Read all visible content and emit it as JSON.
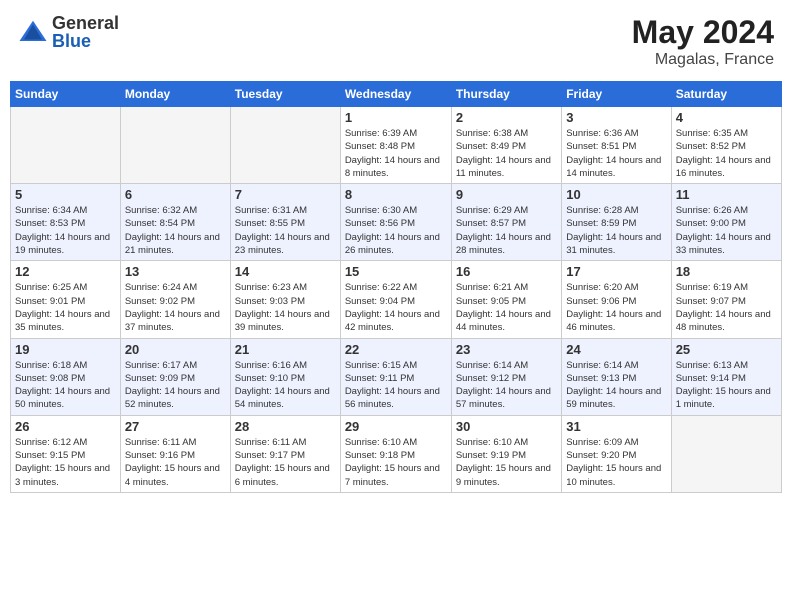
{
  "header": {
    "logo_general": "General",
    "logo_blue": "Blue",
    "month": "May 2024",
    "location": "Magalas, France"
  },
  "weekdays": [
    "Sunday",
    "Monday",
    "Tuesday",
    "Wednesday",
    "Thursday",
    "Friday",
    "Saturday"
  ],
  "weeks": [
    [
      {
        "day": "",
        "empty": true
      },
      {
        "day": "",
        "empty": true
      },
      {
        "day": "",
        "empty": true
      },
      {
        "day": "1",
        "sunrise": "Sunrise: 6:39 AM",
        "sunset": "Sunset: 8:48 PM",
        "daylight": "Daylight: 14 hours and 8 minutes."
      },
      {
        "day": "2",
        "sunrise": "Sunrise: 6:38 AM",
        "sunset": "Sunset: 8:49 PM",
        "daylight": "Daylight: 14 hours and 11 minutes."
      },
      {
        "day": "3",
        "sunrise": "Sunrise: 6:36 AM",
        "sunset": "Sunset: 8:51 PM",
        "daylight": "Daylight: 14 hours and 14 minutes."
      },
      {
        "day": "4",
        "sunrise": "Sunrise: 6:35 AM",
        "sunset": "Sunset: 8:52 PM",
        "daylight": "Daylight: 14 hours and 16 minutes."
      }
    ],
    [
      {
        "day": "5",
        "sunrise": "Sunrise: 6:34 AM",
        "sunset": "Sunset: 8:53 PM",
        "daylight": "Daylight: 14 hours and 19 minutes."
      },
      {
        "day": "6",
        "sunrise": "Sunrise: 6:32 AM",
        "sunset": "Sunset: 8:54 PM",
        "daylight": "Daylight: 14 hours and 21 minutes."
      },
      {
        "day": "7",
        "sunrise": "Sunrise: 6:31 AM",
        "sunset": "Sunset: 8:55 PM",
        "daylight": "Daylight: 14 hours and 23 minutes."
      },
      {
        "day": "8",
        "sunrise": "Sunrise: 6:30 AM",
        "sunset": "Sunset: 8:56 PM",
        "daylight": "Daylight: 14 hours and 26 minutes."
      },
      {
        "day": "9",
        "sunrise": "Sunrise: 6:29 AM",
        "sunset": "Sunset: 8:57 PM",
        "daylight": "Daylight: 14 hours and 28 minutes."
      },
      {
        "day": "10",
        "sunrise": "Sunrise: 6:28 AM",
        "sunset": "Sunset: 8:59 PM",
        "daylight": "Daylight: 14 hours and 31 minutes."
      },
      {
        "day": "11",
        "sunrise": "Sunrise: 6:26 AM",
        "sunset": "Sunset: 9:00 PM",
        "daylight": "Daylight: 14 hours and 33 minutes."
      }
    ],
    [
      {
        "day": "12",
        "sunrise": "Sunrise: 6:25 AM",
        "sunset": "Sunset: 9:01 PM",
        "daylight": "Daylight: 14 hours and 35 minutes."
      },
      {
        "day": "13",
        "sunrise": "Sunrise: 6:24 AM",
        "sunset": "Sunset: 9:02 PM",
        "daylight": "Daylight: 14 hours and 37 minutes."
      },
      {
        "day": "14",
        "sunrise": "Sunrise: 6:23 AM",
        "sunset": "Sunset: 9:03 PM",
        "daylight": "Daylight: 14 hours and 39 minutes."
      },
      {
        "day": "15",
        "sunrise": "Sunrise: 6:22 AM",
        "sunset": "Sunset: 9:04 PM",
        "daylight": "Daylight: 14 hours and 42 minutes."
      },
      {
        "day": "16",
        "sunrise": "Sunrise: 6:21 AM",
        "sunset": "Sunset: 9:05 PM",
        "daylight": "Daylight: 14 hours and 44 minutes."
      },
      {
        "day": "17",
        "sunrise": "Sunrise: 6:20 AM",
        "sunset": "Sunset: 9:06 PM",
        "daylight": "Daylight: 14 hours and 46 minutes."
      },
      {
        "day": "18",
        "sunrise": "Sunrise: 6:19 AM",
        "sunset": "Sunset: 9:07 PM",
        "daylight": "Daylight: 14 hours and 48 minutes."
      }
    ],
    [
      {
        "day": "19",
        "sunrise": "Sunrise: 6:18 AM",
        "sunset": "Sunset: 9:08 PM",
        "daylight": "Daylight: 14 hours and 50 minutes."
      },
      {
        "day": "20",
        "sunrise": "Sunrise: 6:17 AM",
        "sunset": "Sunset: 9:09 PM",
        "daylight": "Daylight: 14 hours and 52 minutes."
      },
      {
        "day": "21",
        "sunrise": "Sunrise: 6:16 AM",
        "sunset": "Sunset: 9:10 PM",
        "daylight": "Daylight: 14 hours and 54 minutes."
      },
      {
        "day": "22",
        "sunrise": "Sunrise: 6:15 AM",
        "sunset": "Sunset: 9:11 PM",
        "daylight": "Daylight: 14 hours and 56 minutes."
      },
      {
        "day": "23",
        "sunrise": "Sunrise: 6:14 AM",
        "sunset": "Sunset: 9:12 PM",
        "daylight": "Daylight: 14 hours and 57 minutes."
      },
      {
        "day": "24",
        "sunrise": "Sunrise: 6:14 AM",
        "sunset": "Sunset: 9:13 PM",
        "daylight": "Daylight: 14 hours and 59 minutes."
      },
      {
        "day": "25",
        "sunrise": "Sunrise: 6:13 AM",
        "sunset": "Sunset: 9:14 PM",
        "daylight": "Daylight: 15 hours and 1 minute."
      }
    ],
    [
      {
        "day": "26",
        "sunrise": "Sunrise: 6:12 AM",
        "sunset": "Sunset: 9:15 PM",
        "daylight": "Daylight: 15 hours and 3 minutes."
      },
      {
        "day": "27",
        "sunrise": "Sunrise: 6:11 AM",
        "sunset": "Sunset: 9:16 PM",
        "daylight": "Daylight: 15 hours and 4 minutes."
      },
      {
        "day": "28",
        "sunrise": "Sunrise: 6:11 AM",
        "sunset": "Sunset: 9:17 PM",
        "daylight": "Daylight: 15 hours and 6 minutes."
      },
      {
        "day": "29",
        "sunrise": "Sunrise: 6:10 AM",
        "sunset": "Sunset: 9:18 PM",
        "daylight": "Daylight: 15 hours and 7 minutes."
      },
      {
        "day": "30",
        "sunrise": "Sunrise: 6:10 AM",
        "sunset": "Sunset: 9:19 PM",
        "daylight": "Daylight: 15 hours and 9 minutes."
      },
      {
        "day": "31",
        "sunrise": "Sunrise: 6:09 AM",
        "sunset": "Sunset: 9:20 PM",
        "daylight": "Daylight: 15 hours and 10 minutes."
      },
      {
        "day": "",
        "empty": true
      }
    ]
  ]
}
